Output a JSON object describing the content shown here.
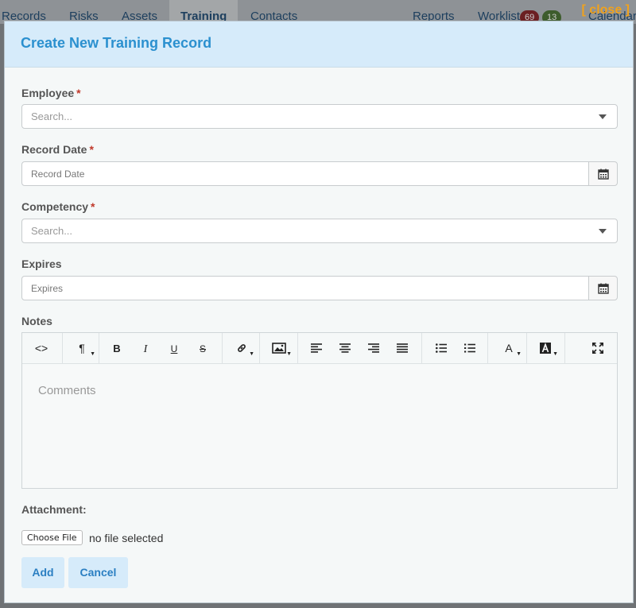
{
  "background_nav": {
    "tabs": [
      "Records",
      "Risks",
      "Assets",
      "Training",
      "Contacts",
      "Reports",
      "Worklist",
      "Calendar"
    ],
    "active_tab": "Training",
    "worklist_badge_red": "69",
    "worklist_badge_green": "13",
    "close_label": "[ close ]"
  },
  "modal": {
    "title": "Create New Training Record",
    "employee": {
      "label": "Employee",
      "required_mark": "*",
      "placeholder": "Search..."
    },
    "record_date": {
      "label": "Record Date",
      "required_mark": "*",
      "placeholder": "Record Date"
    },
    "competency": {
      "label": "Competency",
      "required_mark": "*",
      "placeholder": "Search..."
    },
    "expires": {
      "label": "Expires",
      "placeholder": "Expires"
    },
    "notes": {
      "label": "Notes",
      "placeholder": "Comments",
      "toolbar": {
        "code": "<>",
        "paragraph": "¶",
        "bold": "B",
        "italic": "I",
        "underline": "U",
        "strike": "S",
        "font_color": "A"
      }
    },
    "attachment": {
      "label": "Attachment:",
      "choose_file": "Choose File",
      "no_file": "no file selected"
    },
    "buttons": {
      "add": "Add",
      "cancel": "Cancel"
    }
  }
}
